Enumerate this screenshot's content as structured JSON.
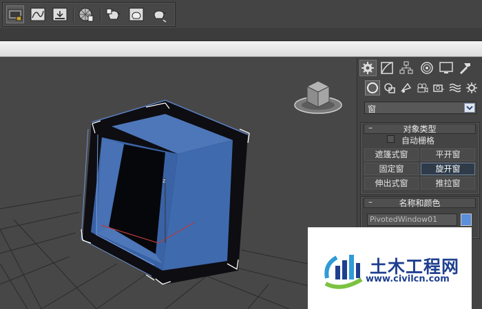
{
  "toolbar": {
    "buttons": [
      {
        "icon": "render-setup-icon",
        "active": true
      },
      {
        "icon": "curve-editor-icon"
      },
      {
        "icon": "render-frame-icon"
      },
      {
        "icon": "material-editor-icon"
      },
      {
        "icon": "render-production-icon"
      },
      {
        "icon": "render-iterative-icon"
      },
      {
        "icon": "render-activeshade-icon"
      }
    ]
  },
  "command_panel": {
    "tabs": [
      "create-tab-icon",
      "modify-tab-icon",
      "hierarchy-tab-icon",
      "motion-tab-icon",
      "display-tab-icon",
      "utilities-tab-icon"
    ],
    "category_icons": [
      "geometry-icon",
      "shapes-icon",
      "lights-icon",
      "cameras-icon",
      "helpers-icon",
      "spacewarps-icon",
      "systems-icon"
    ],
    "category_dropdown": "窗",
    "object_type": {
      "title": "对象类型",
      "autogrid_label": "自动栅格",
      "buttons": [
        "遮篷式窗",
        "平开窗",
        "固定窗",
        "旋开窗",
        "伸出式窗",
        "推拉窗"
      ],
      "active_button": "旋开窗"
    },
    "name_color": {
      "title": "名称和颜色",
      "name_value": "PivotedWindow01",
      "color": "#5b8edb"
    }
  },
  "viewport": {
    "axis_z_label": "z"
  },
  "watermark": {
    "cn_text": "土木工程网",
    "url": "www.civilcn.com"
  }
}
